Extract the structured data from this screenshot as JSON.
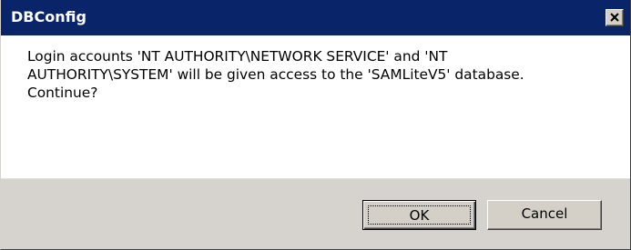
{
  "window": {
    "title": "DBConfig",
    "close_icon": "close-x-icon"
  },
  "message": {
    "text": "Login accounts 'NT AUTHORITY\\NETWORK SERVICE' and 'NT\nAUTHORITY\\SYSTEM' will be given access to the 'SAMLiteV5' database.\nContinue?"
  },
  "buttons": {
    "ok_label": "OK",
    "cancel_label": "Cancel"
  },
  "colors": {
    "titlebar": "#0a246a",
    "button_face": "#d4d0c8",
    "footer": "#d6d3ce"
  }
}
